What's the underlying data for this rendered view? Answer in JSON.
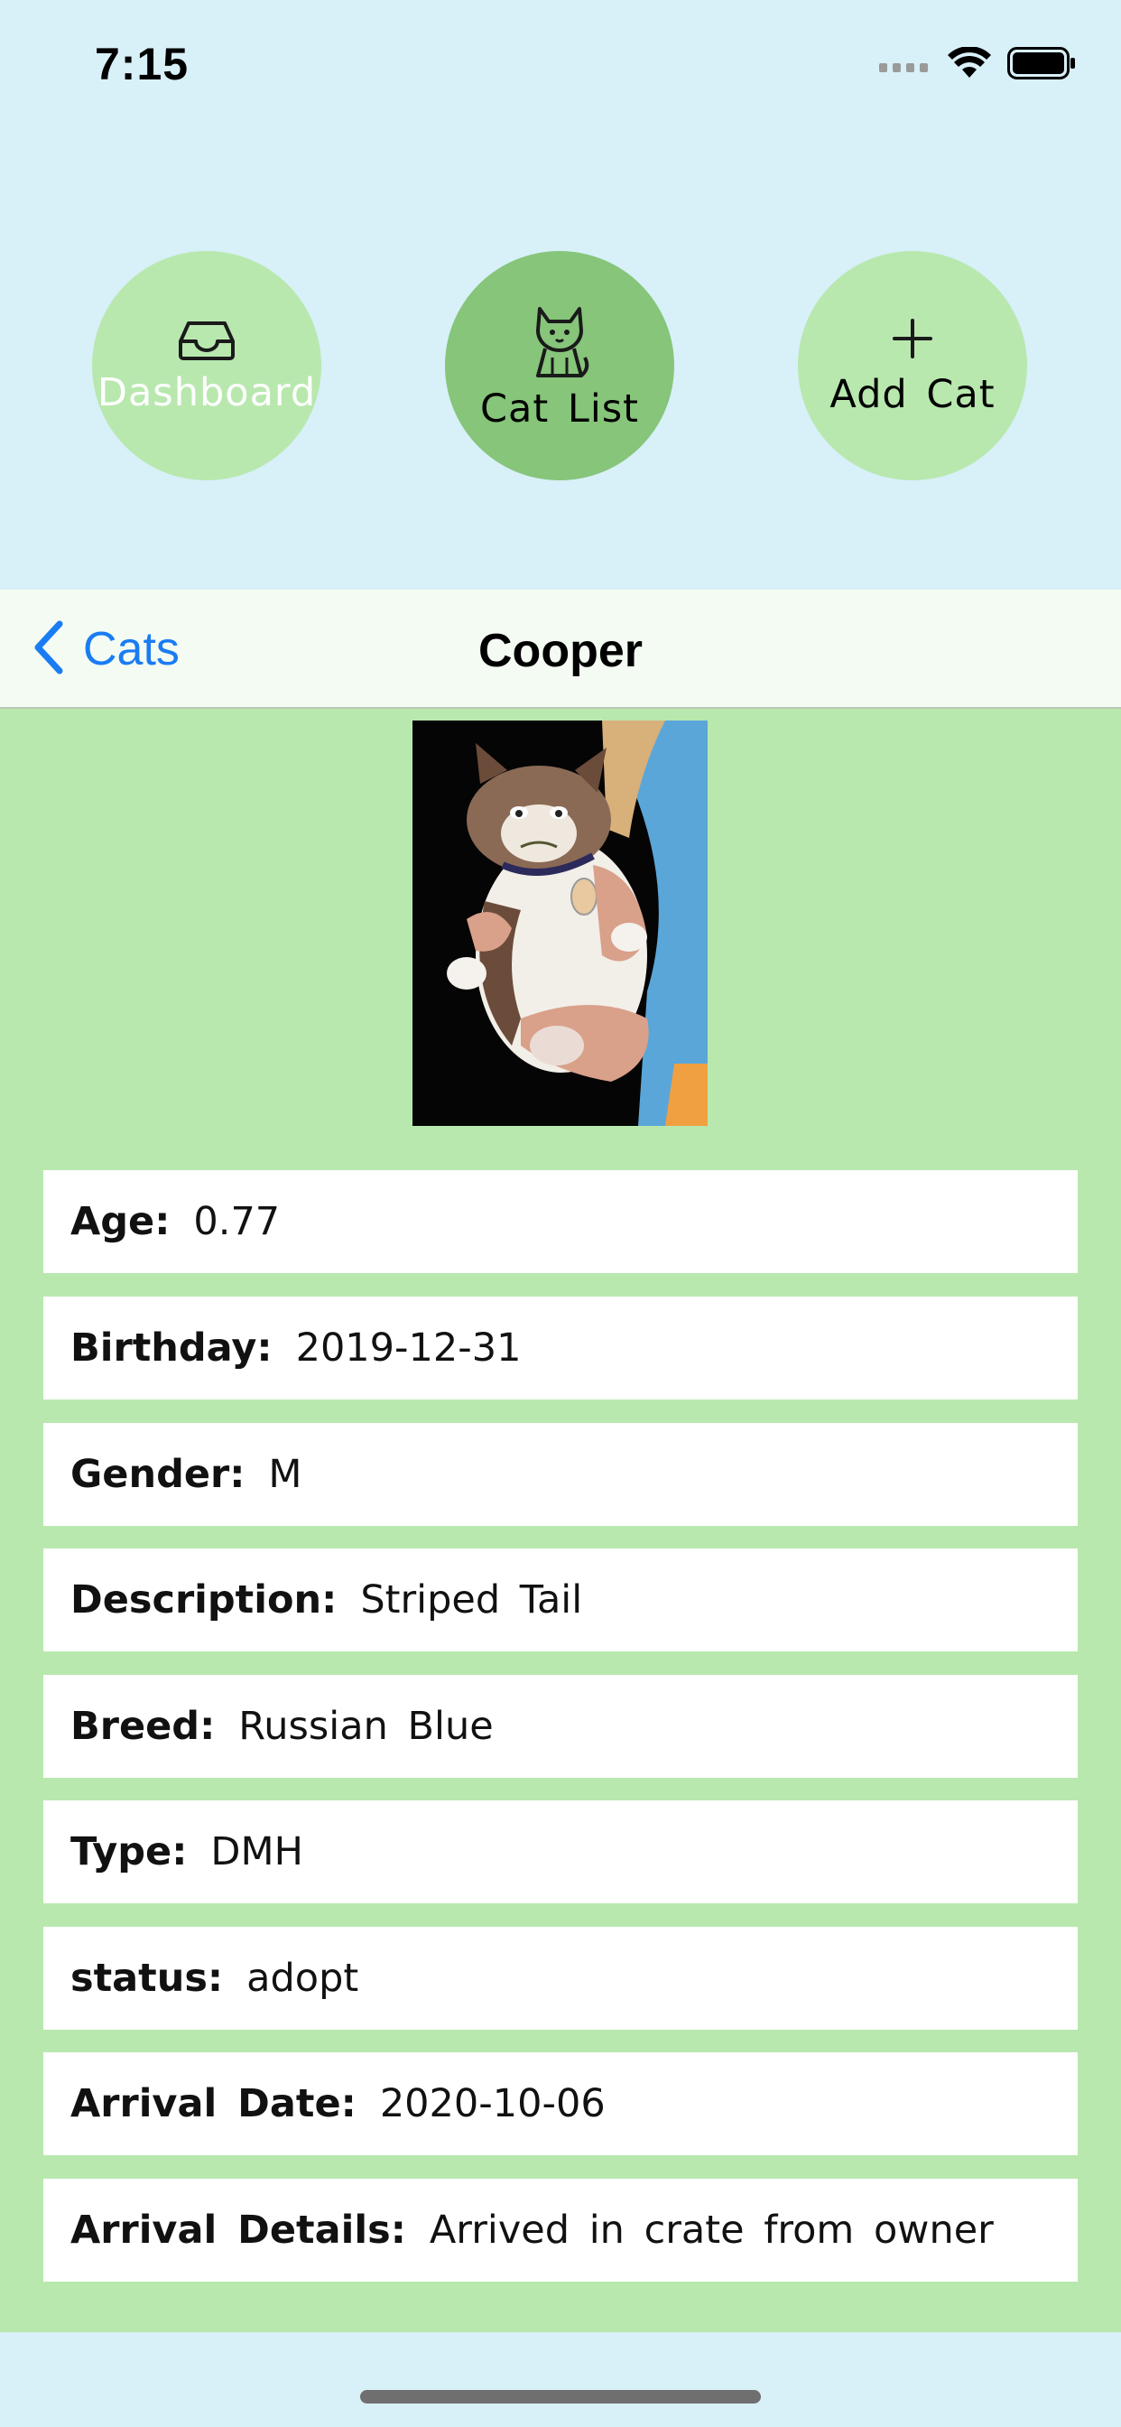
{
  "status_bar": {
    "time": "7:15"
  },
  "top_nav": {
    "dashboard_label": "Dashboard",
    "catlist_label": "Cat List",
    "addcat_label": "Add Cat",
    "add_icon_glyph": "+"
  },
  "nav_bar": {
    "back_label": "Cats",
    "title": "Cooper"
  },
  "details": [
    {
      "key": "Age:",
      "value": "0.77"
    },
    {
      "key": "Birthday:",
      "value": "2019-12-31"
    },
    {
      "key": "Gender:",
      "value": "M"
    },
    {
      "key": "Description:",
      "value": "Striped Tail"
    },
    {
      "key": "Breed:",
      "value": "Russian Blue"
    },
    {
      "key": "Type:",
      "value": "DMH"
    },
    {
      "key": "status:",
      "value": "adopt"
    },
    {
      "key": "Arrival Date:",
      "value": "2020-10-06"
    },
    {
      "key": "Arrival Details:",
      "value": "Arrived in crate from owner"
    }
  ],
  "colors": {
    "background": "#d8f0f8",
    "content_green": "#b8e8ae",
    "active_button": "#86c57a",
    "link_blue": "#1a7cf2"
  },
  "icons": [
    "cellular-signal-icon",
    "wifi-icon",
    "battery-icon",
    "inbox-icon",
    "cat-icon",
    "plus-icon",
    "chevron-left-icon"
  ]
}
